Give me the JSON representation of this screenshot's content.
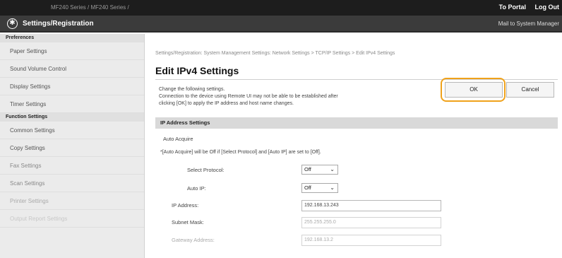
{
  "topbar": {
    "model": "MF240 Series / MF240 Series /",
    "to_portal": "To Portal",
    "log_out": "Log Out"
  },
  "titlebar": {
    "title": "Settings/Registration",
    "mail": "Mail to System Manager",
    "icon": "settings-globe-icon"
  },
  "sidebar": {
    "preferences_head": "Preferences",
    "preferences": [
      "Paper Settings",
      "Sound Volume Control",
      "Display Settings",
      "Timer Settings"
    ],
    "function_head": "Function Settings",
    "functions": [
      "Common Settings",
      "Copy Settings",
      "Fax Settings",
      "Scan Settings",
      "Printer Settings",
      "Output Report Settings"
    ]
  },
  "main": {
    "breadcrumb": "Settings/Registration: System Management Settings: Network Settings > TCP/IP Settings > Edit IPv4 Settings",
    "title": "Edit IPv4 Settings",
    "desc_line1": "Change the following settings.",
    "desc_line2": "Connection to the device using Remote UI may not be able to be established after",
    "desc_line3": "clicking [OK] to apply the IP address and host name changes.",
    "ok_label": "OK",
    "cancel_label": "Cancel",
    "section_title": "IP Address Settings",
    "auto_acquire_label": "Auto Acquire",
    "auto_note": "*[Auto Acquire] will be Off if [Select Protocol] and [Auto IP] are set to [Off].",
    "select_protocol_label": "Select Protocol:",
    "select_protocol_value": "Off",
    "auto_ip_label": "Auto IP:",
    "auto_ip_value": "Off",
    "ip_address_label": "IP Address:",
    "ip_address_value": "192.168.13.243",
    "subnet_mask_label": "Subnet Mask:",
    "subnet_mask_value": "255.255.255.0",
    "gateway_label": "Gateway Address:",
    "gateway_value": "192.168.13.2"
  },
  "colors": {
    "highlight_ring": "#f0a21b",
    "topbar": "#1d1d1d",
    "titlebar": "#3b3b3b"
  }
}
